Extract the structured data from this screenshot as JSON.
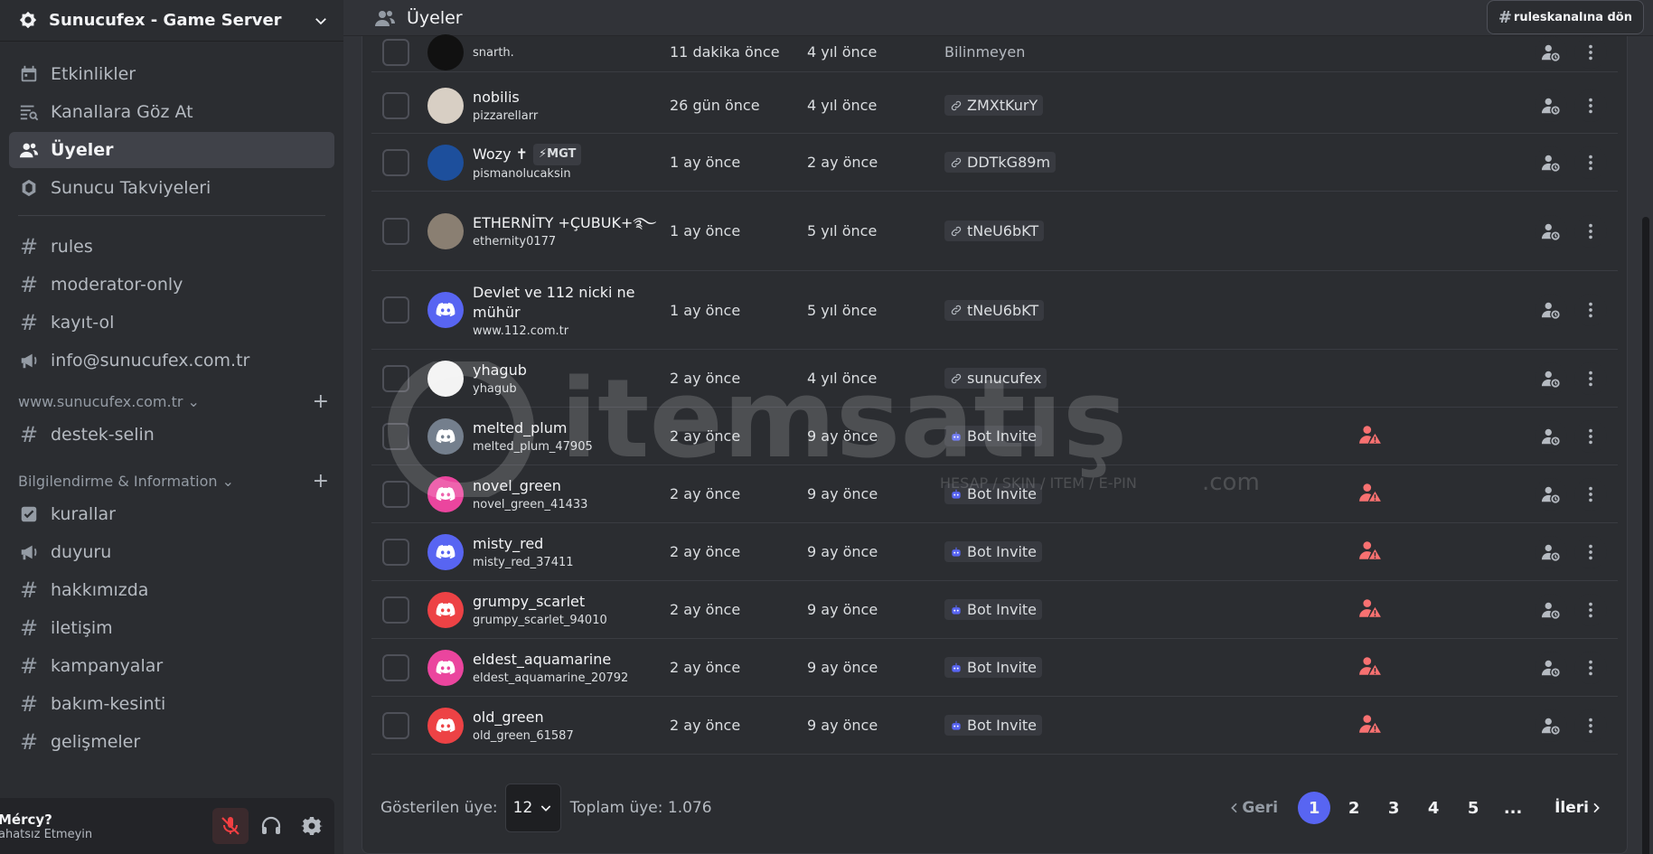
{
  "server": {
    "name": "Sunucufex - Game Server"
  },
  "sidebar": {
    "top_items": [
      {
        "label": "Etkinlikler"
      },
      {
        "label": "Kanallara Göz At"
      },
      {
        "label": "Üyeler"
      },
      {
        "label": "Sunucu Takviyeleri"
      }
    ],
    "channels_a": [
      {
        "label": "rules"
      },
      {
        "label": "moderator-only"
      },
      {
        "label": "kayıt-ol"
      },
      {
        "label": "info@sunucufex.com.tr"
      }
    ],
    "category_1": {
      "label": "www.sunucufex.com.tr"
    },
    "channels_b": [
      {
        "label": "destek-selin"
      }
    ],
    "category_2": {
      "label": "Bilgilendirme & Information"
    },
    "channels_c": [
      {
        "label": "kurallar"
      },
      {
        "label": "duyuru"
      },
      {
        "label": "hakkımızda"
      },
      {
        "label": "iletişim"
      },
      {
        "label": "kampanyalar"
      },
      {
        "label": "bakım-kesinti"
      },
      {
        "label": "gelişmeler"
      }
    ]
  },
  "user_panel": {
    "name": "Mércy?",
    "status": "ahatsız Etmeyin"
  },
  "topbar": {
    "title": "Üyeler",
    "back_label": "ruleskanalına dön"
  },
  "members": [
    {
      "display": "",
      "username": "snarth.",
      "joined": "11 dakika önce",
      "account_age": "4 yıl önce",
      "method": "Bilinmeyen",
      "method_type": "unknown",
      "avatar_color": "#111111",
      "flag": false
    },
    {
      "display": "nobilis",
      "username": "pizzarellarr",
      "joined": "26 gün önce",
      "account_age": "4 yıl önce",
      "method": "ZMXtKurY",
      "method_type": "invite",
      "avatar_color": "#d8cfc4",
      "flag": false
    },
    {
      "display": "Wozy ✝",
      "tag": "⚡MGT",
      "username": "pismanolucaksin",
      "joined": "1 ay önce",
      "account_age": "2 ay önce",
      "method": "DDTkG89m",
      "method_type": "invite",
      "avatar_color": "#1d4f9c",
      "flag": false
    },
    {
      "display": "ETHERNİTY +ÇUBUK+࿐",
      "username": "ethernity0177",
      "joined": "1 ay önce",
      "account_age": "5 yıl önce",
      "method": "tNeU6bKT",
      "method_type": "invite",
      "avatar_color": "#8a7f72",
      "flag": false
    },
    {
      "display": "Devlet ve 112 nicki ne mühür",
      "username": "www.112.com.tr",
      "joined": "1 ay önce",
      "account_age": "5 yıl önce",
      "method": "tNeU6bKT",
      "method_type": "invite",
      "avatar_color": "#5865f2",
      "flag": false
    },
    {
      "display": "yhagub",
      "username": "yhagub",
      "joined": "2 ay önce",
      "account_age": "4 yıl önce",
      "method": "sunucufex",
      "method_type": "invite",
      "avatar_color": "#f3f3f3",
      "flag": false
    },
    {
      "display": "melted_plum",
      "username": "melted_plum_47905",
      "joined": "2 ay önce",
      "account_age": "9 ay önce",
      "method": "Bot Invite",
      "method_type": "bot",
      "avatar_color": "#747f8d",
      "flag": true
    },
    {
      "display": "novel_green",
      "username": "novel_green_41433",
      "joined": "2 ay önce",
      "account_age": "9 ay önce",
      "method": "Bot Invite",
      "method_type": "bot",
      "avatar_color": "#eb459e",
      "flag": true
    },
    {
      "display": "misty_red",
      "username": "misty_red_37411",
      "joined": "2 ay önce",
      "account_age": "9 ay önce",
      "method": "Bot Invite",
      "method_type": "bot",
      "avatar_color": "#5865f2",
      "flag": true
    },
    {
      "display": "grumpy_scarlet",
      "username": "grumpy_scarlet_94010",
      "joined": "2 ay önce",
      "account_age": "9 ay önce",
      "method": "Bot Invite",
      "method_type": "bot",
      "avatar_color": "#ed4245",
      "flag": true
    },
    {
      "display": "eldest_aquamarine",
      "username": "eldest_aquamarine_20792",
      "joined": "2 ay önce",
      "account_age": "9 ay önce",
      "method": "Bot Invite",
      "method_type": "bot",
      "avatar_color": "#eb459e",
      "flag": true
    },
    {
      "display": "old_green",
      "username": "old_green_61587",
      "joined": "2 ay önce",
      "account_age": "9 ay önce",
      "method": "Bot Invite",
      "method_type": "bot",
      "avatar_color": "#ed4245",
      "flag": true
    }
  ],
  "footer": {
    "shown_label": "Gösterilen üye:",
    "page_size": "12",
    "total_label": "Toplam üye: 1.076",
    "prev_label": "Geri",
    "next_label": "İleri",
    "pages": [
      "1",
      "2",
      "3",
      "4",
      "5",
      "..."
    ],
    "current_page": "1"
  },
  "watermark": {
    "brand": "itemsatış",
    "tagline": "HESAP / SKIN / ITEM / E-PIN",
    "suffix": ".com"
  },
  "colors": {
    "accent": "#5865f2",
    "flag": "#f87171",
    "background": "#313338",
    "sidebar": "#2b2d31"
  }
}
